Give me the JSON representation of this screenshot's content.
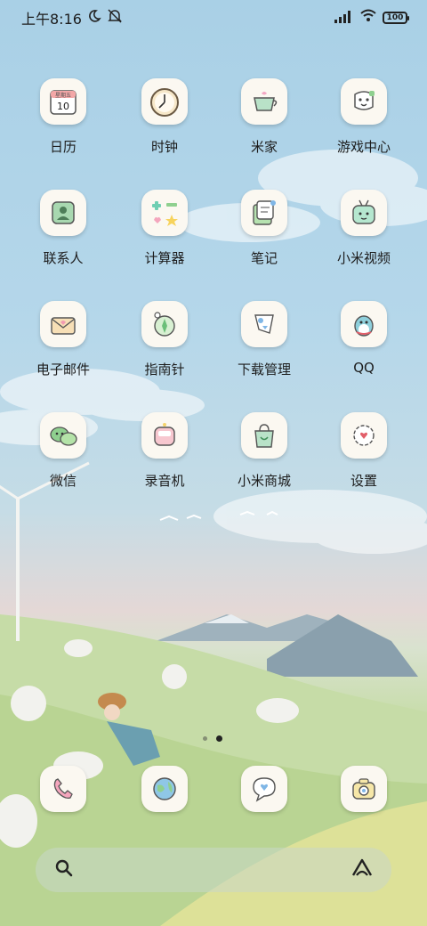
{
  "status_bar": {
    "time": "上午8:16",
    "battery": "100"
  },
  "apps": [
    {
      "label": "日历",
      "icon": "calendar-icon",
      "calendar_day": "星期五",
      "calendar_date": "10"
    },
    {
      "label": "时钟",
      "icon": "clock-icon"
    },
    {
      "label": "米家",
      "icon": "teacup-icon"
    },
    {
      "label": "游戏中心",
      "icon": "game-controller-icon"
    },
    {
      "label": "联系人",
      "icon": "contacts-icon"
    },
    {
      "label": "计算器",
      "icon": "calculator-icon"
    },
    {
      "label": "笔记",
      "icon": "notes-icon"
    },
    {
      "label": "小米视频",
      "icon": "tv-icon"
    },
    {
      "label": "电子邮件",
      "icon": "envelope-icon"
    },
    {
      "label": "指南针",
      "icon": "compass-icon"
    },
    {
      "label": "下载管理",
      "icon": "download-icon"
    },
    {
      "label": "QQ",
      "icon": "penguin-icon"
    },
    {
      "label": "微信",
      "icon": "chat-bubbles-icon"
    },
    {
      "label": "录音机",
      "icon": "recorder-icon"
    },
    {
      "label": "小米商城",
      "icon": "shopping-bag-icon"
    },
    {
      "label": "设置",
      "icon": "gear-heart-icon"
    }
  ],
  "dock": [
    {
      "icon": "phone-icon"
    },
    {
      "icon": "globe-icon"
    },
    {
      "icon": "message-heart-icon"
    },
    {
      "icon": "camera-icon"
    }
  ],
  "colors": {
    "sky": "#a9d0e6",
    "grass": "#b8d49a",
    "icon_bg": "#fbf8f1"
  }
}
